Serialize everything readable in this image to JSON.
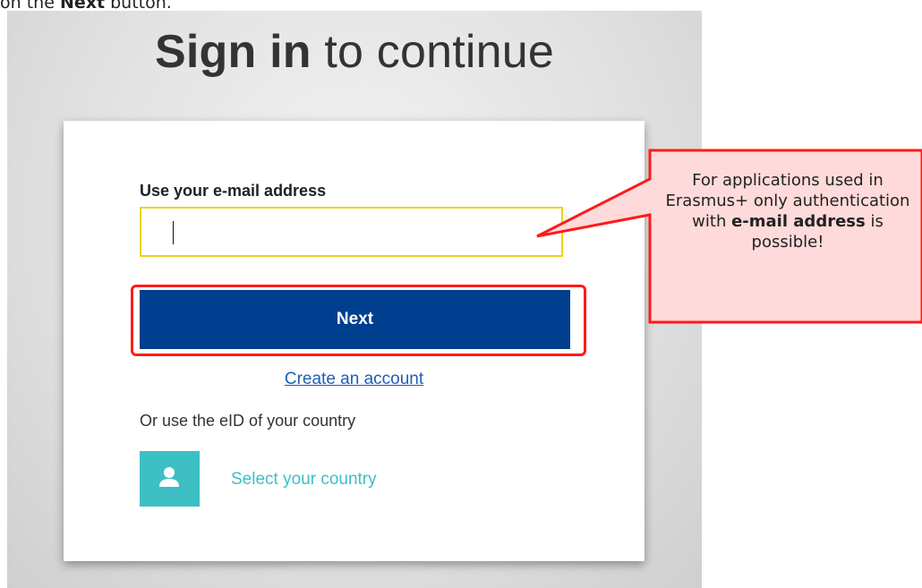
{
  "caption": {
    "prefix": "on the ",
    "bold": "Next",
    "suffix": " button."
  },
  "heading": {
    "strong": "Sign in",
    "rest": " to continue"
  },
  "form": {
    "email_label": "Use your e-mail address",
    "email_value": "",
    "next_button": "Next",
    "create_account": "Create an account",
    "alt_text": "Or use the eID of your country",
    "select_country": "Select your country"
  },
  "callout": {
    "line1": "For applications used in Erasmus+ only authentication with ",
    "bold": "e-mail address",
    "line2": " is possible!"
  },
  "colors": {
    "next_button": "#003f8f",
    "input_border": "#f0d21a",
    "highlight": "#ff1a1a",
    "callout_fill": "#ffdada",
    "eid_tile": "#3dbfc4"
  },
  "icons": {
    "eid": "user-icon"
  }
}
